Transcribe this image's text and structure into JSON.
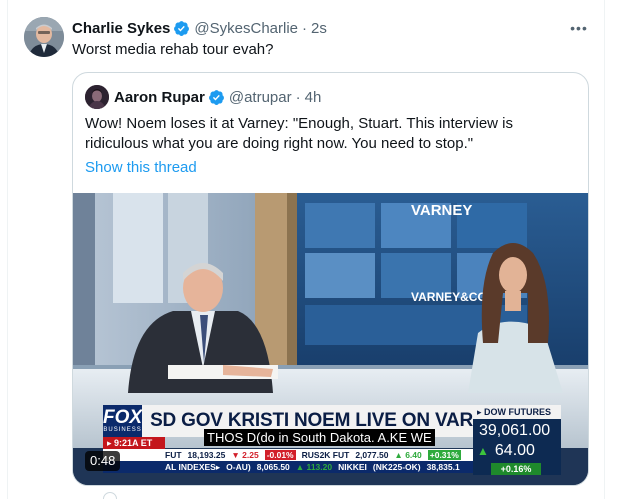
{
  "tweet": {
    "author_name": "Charlie Sykes",
    "author_handle": "@SykesCharlie",
    "separator": "·",
    "time": "2s",
    "text": "Worst media rehab tour evah?",
    "more_label": "•••"
  },
  "quote": {
    "author_name": "Aaron Rupar",
    "author_handle": "@atrupar",
    "separator": "·",
    "time": "4h",
    "text_line1": "Wow! Noem loses it at Varney: \"Enough, Stuart. This interview is",
    "text_line2": "ridiculous what you are doing right now. You need to stop.\"",
    "show_thread": "Show this thread"
  },
  "video": {
    "duration": "0:48",
    "network_logo": "FOX",
    "network_sub": "BUSINESS",
    "headline": "SD GOV KRISTI NOEM LIVE ON VARNEY",
    "clock": "9:21A ET",
    "caption": "THOS D(do in South Dakota. A.KE WE",
    "set_sign_1": "VARNEY",
    "set_sign_2": "VARNEY&CO.",
    "dow": {
      "label": "▸ DOW FUTURES",
      "value": "39,061.00",
      "change": "64.00",
      "percent": "+0.16%"
    },
    "ticker_top": [
      "FUT",
      "18,193.25",
      "▼ 2.25",
      "-0.01%",
      "RUS2K FUT",
      "2,077.50",
      "▲ 6.40",
      "+0.31%"
    ],
    "ticker_bottom": [
      "AL INDEXES▸",
      "O-AU)",
      "8,065.50",
      "▲ 113.20",
      "NIKKEI",
      "(NK225-OK)",
      "38,835.1"
    ]
  },
  "colors": {
    "link": "#1d9bf0",
    "verified": "#1d9bf0",
    "fox_blue": "#0b2a6b",
    "fox_red": "#c4161c",
    "up_green": "#2eaa3c"
  }
}
